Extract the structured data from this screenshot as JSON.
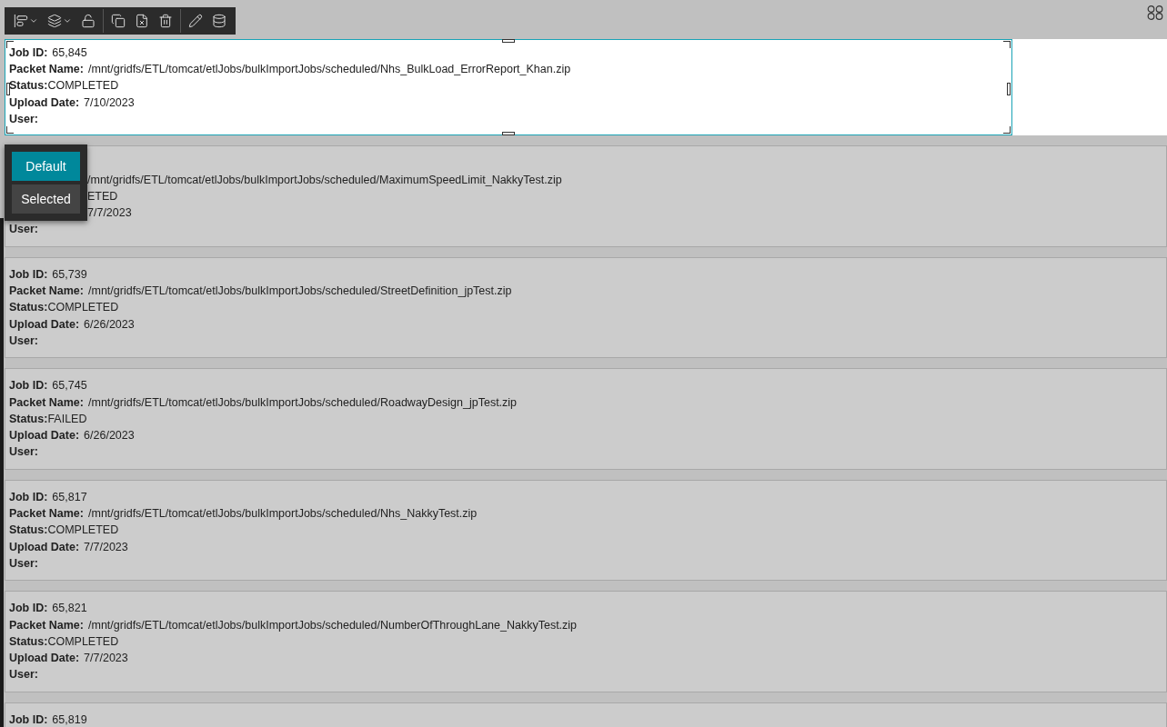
{
  "toolbar": {
    "items": [
      {
        "kind": "align",
        "caret": true
      },
      {
        "kind": "layers",
        "caret": true
      },
      {
        "kind": "unlock"
      },
      {
        "kind": "divider"
      },
      {
        "kind": "copy"
      },
      {
        "kind": "hide"
      },
      {
        "kind": "delete"
      },
      {
        "kind": "divider"
      },
      {
        "kind": "edit"
      },
      {
        "kind": "data"
      }
    ]
  },
  "cards": [
    {
      "selected": true,
      "lines": [
        {
          "label": "Job ID:",
          "value": "65,845"
        },
        {
          "label": "Packet Name:",
          "value": "/mnt/gridfs/ETL/tomcat/etlJobs/bulkImportJobs/scheduled/Nhs_BulkLoad_ErrorReport_Khan.zip"
        },
        {
          "text": "**Status:**COMPLETED"
        },
        {
          "label": "Upload Date:",
          "value": "7/10/2023"
        },
        {
          "label": "User:"
        }
      ]
    },
    {
      "selected": false,
      "covered": true,
      "lines": [
        {
          "value": "/mnt/gridfs/ETL/tomcat/etlJobs/bulkImportJobs/scheduled/MaximumSpeedLimit_NakkyTest.zip"
        },
        {
          "value": "ETED"
        },
        {
          "value": "7/7/2023"
        },
        {
          "label": "User:"
        }
      ]
    },
    {
      "selected": false,
      "lines": [
        {
          "label": "Job ID:",
          "value": "65,739"
        },
        {
          "label": "Packet Name:",
          "value": "/mnt/gridfs/ETL/tomcat/etlJobs/bulkImportJobs/scheduled/StreetDefinition_jpTest.zip"
        },
        {
          "text": "**Status:**COMPLETED"
        },
        {
          "label": "Upload Date:",
          "value": "6/26/2023"
        },
        {
          "label": "User:"
        }
      ]
    },
    {
      "selected": false,
      "lines": [
        {
          "label": "Job ID:",
          "value": "65,745"
        },
        {
          "label": "Packet Name:",
          "value": "/mnt/gridfs/ETL/tomcat/etlJobs/bulkImportJobs/scheduled/RoadwayDesign_jpTest.zip"
        },
        {
          "text": "**Status:**FAILED"
        },
        {
          "label": "Upload Date:",
          "value": "6/26/2023"
        },
        {
          "label": "User:"
        }
      ]
    },
    {
      "selected": false,
      "lines": [
        {
          "label": "Job ID:",
          "value": "65,817"
        },
        {
          "label": "Packet Name:",
          "value": "/mnt/gridfs/ETL/tomcat/etlJobs/bulkImportJobs/scheduled/Nhs_NakkyTest.zip"
        },
        {
          "text": "**Status:**COMPLETED"
        },
        {
          "label": "Upload Date:",
          "value": "7/7/2023"
        },
        {
          "label": "User:"
        }
      ]
    },
    {
      "selected": false,
      "lines": [
        {
          "label": "Job ID:",
          "value": "65,821"
        },
        {
          "label": "Packet Name:",
          "value": "/mnt/gridfs/ETL/tomcat/etlJobs/bulkImportJobs/scheduled/NumberOfThroughLane_NakkyTest.zip"
        },
        {
          "text": "**Status:**COMPLETED"
        },
        {
          "label": "Upload Date:",
          "value": "7/7/2023"
        },
        {
          "label": "User:"
        }
      ]
    },
    {
      "selected": false,
      "lines": [
        {
          "label": "Job ID:",
          "value": "65,819"
        }
      ]
    }
  ],
  "state_menu": {
    "options": [
      {
        "label": "Default",
        "selected": true
      },
      {
        "label": "Selected",
        "selected": false
      }
    ]
  }
}
